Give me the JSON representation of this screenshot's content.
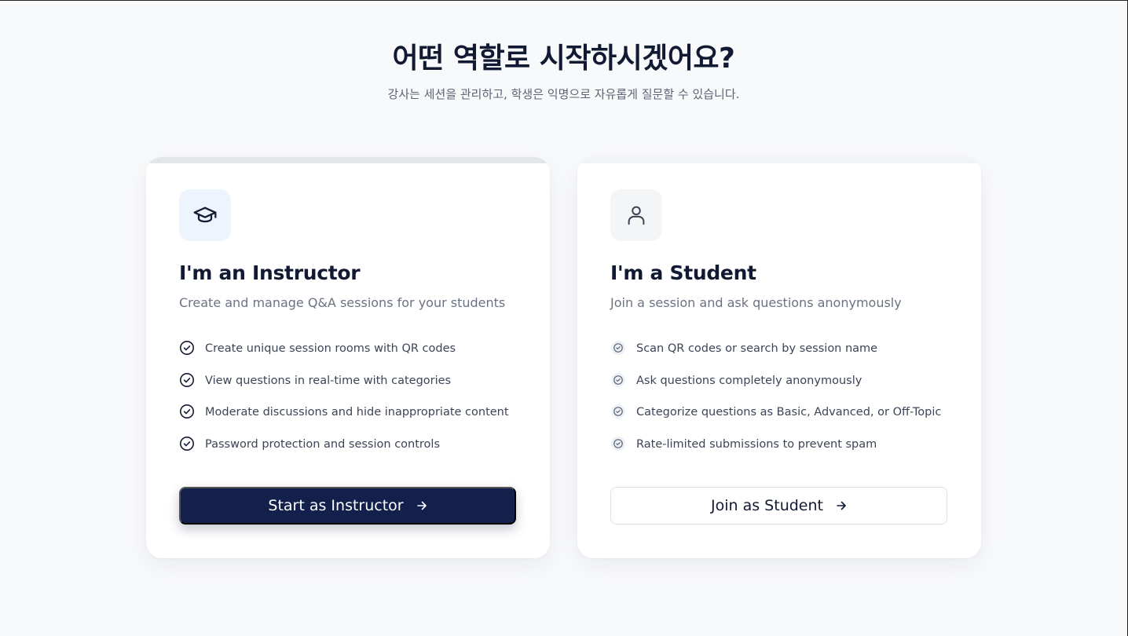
{
  "header": {
    "title": "어떤 역할로 시작하시겠어요?",
    "subtitle": "강사는 세션을 관리하고, 학생은 익명으로 자유롭게 질문할 수 있습니다."
  },
  "instructor": {
    "icon": "graduation-cap-icon",
    "title": "I'm an Instructor",
    "description": "Create and manage Q&A sessions for your students",
    "features": [
      "Create unique session rooms with QR codes",
      "View questions in real-time with categories",
      "Moderate discussions and hide inappropriate content",
      "Password protection and session controls"
    ],
    "cta_label": "Start as Instructor",
    "accent_color": "#12204b"
  },
  "student": {
    "icon": "user-icon",
    "title": "I'm a Student",
    "description": "Join a session and ask questions anonymously",
    "features": [
      "Scan QR codes or search by session name",
      "Ask questions completely anonymously",
      "Categorize questions as Basic, Advanced, or Off-Topic",
      "Rate-limited submissions to prevent spam"
    ],
    "cta_label": "Join as Student",
    "accent_color": "#ffffff"
  }
}
